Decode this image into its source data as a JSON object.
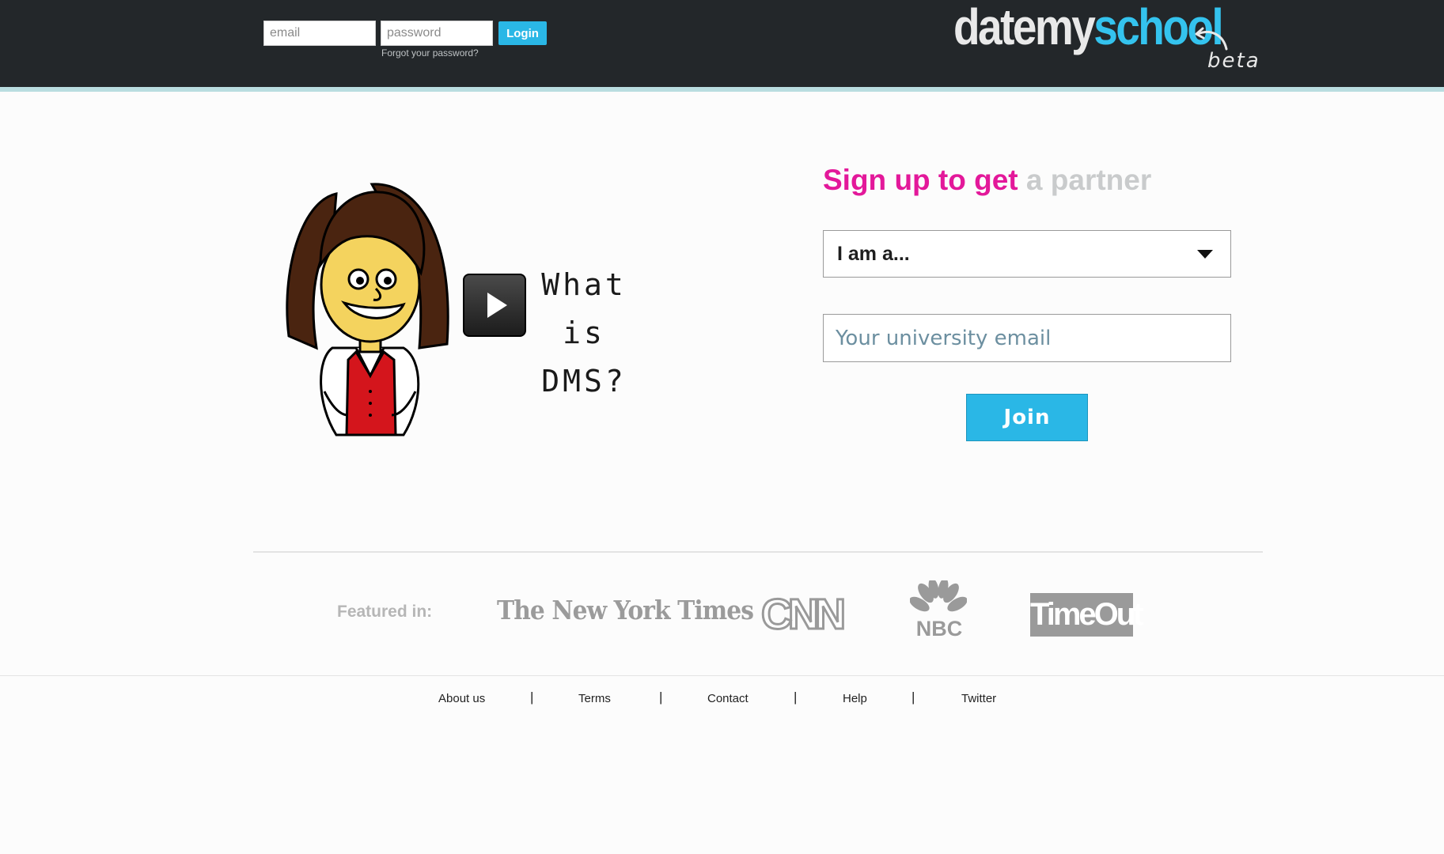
{
  "header": {
    "email_placeholder": "email",
    "password_placeholder": "password",
    "login_label": "Login",
    "forgot_password": "Forgot your password?",
    "logo_part1": "datemy",
    "logo_part2": "school",
    "beta_label": "beta"
  },
  "hero": {
    "video_caption_lines": [
      "What",
      "is",
      "DMS?"
    ],
    "play_icon": "play-icon"
  },
  "signup": {
    "title_highlight": "Sign up to get",
    "title_rest": "a partner",
    "select_label": "I am a...",
    "email_placeholder": "Your university email",
    "join_label": "Join"
  },
  "featured": {
    "label": "Featured in:",
    "outlets": [
      "The New York Times",
      "CNN",
      "NBC",
      "TimeOut"
    ]
  },
  "footer": {
    "links": [
      "About us",
      "Terms",
      "Contact",
      "Help",
      "Twitter"
    ],
    "separator": "|"
  },
  "colors": {
    "accent": "#2ab7e6",
    "brand_pink": "#e3189a",
    "topbar": "#23272a",
    "topbar_border": "#b9dde0"
  }
}
